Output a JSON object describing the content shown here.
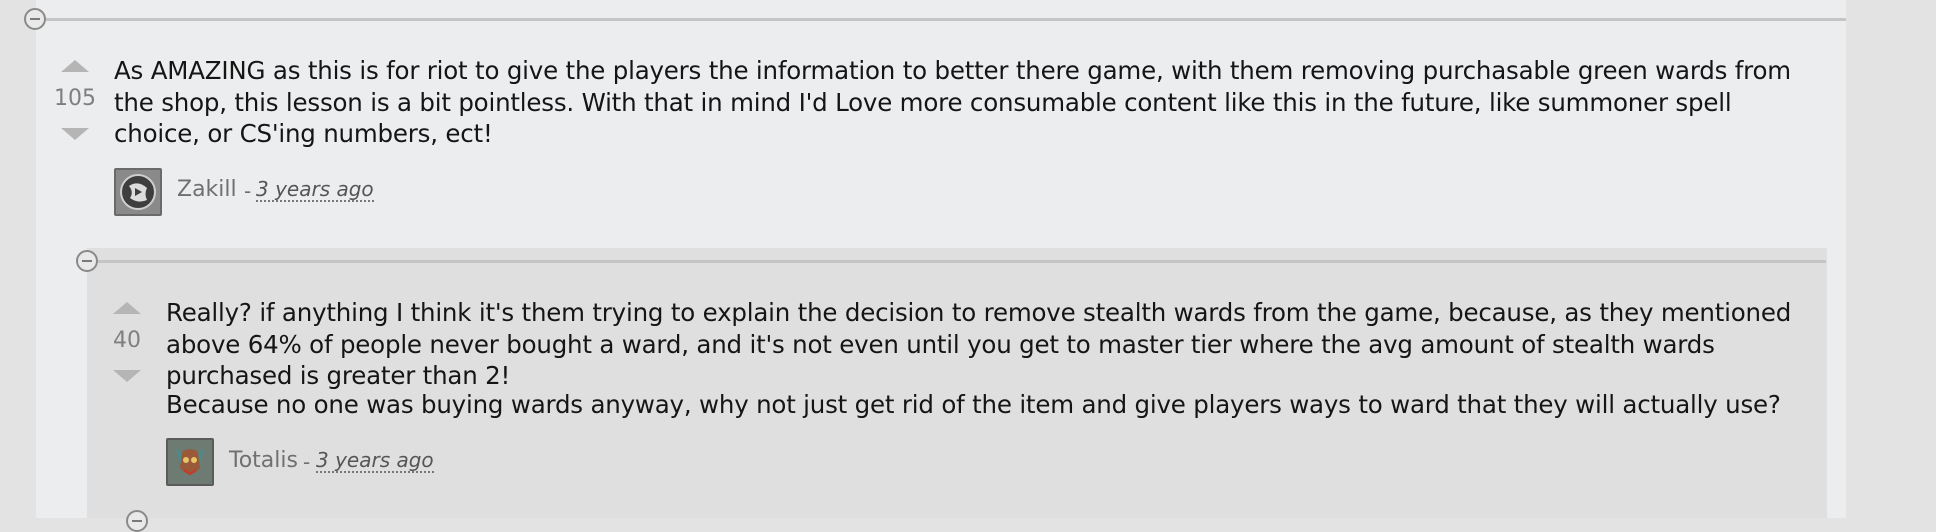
{
  "comments": [
    {
      "votes": "105",
      "text": "As AMAZING as this is for riot to give the players the information to better there game, with them removing purchasable green wards from the shop, this lesson is a bit pointless. With that in mind I'd Love more consumable content like this in the future, like summoner spell choice, or CS'ing numbers, ect!",
      "author": "Zakill",
      "separator": "-",
      "time": "3 years ago"
    },
    {
      "votes": "40",
      "text": "Really? if anything I think it's them trying to explain the decision to remove stealth wards from the game, because, as they mentioned above 64% of people never bought a ward, and it's not even until you get to master tier where the avg amount of stealth wards purchased is greater than 2!",
      "text2": "Because no one was buying wards anyway, why not just get rid of the item and give players ways to ward that they will actually use?",
      "author": "Totalis",
      "separator": "-",
      "time": "3 years ago"
    }
  ],
  "colors": {
    "page_bg": "#e3e3e3",
    "outer_panel": "#ecedee",
    "inner_panel": "#dfdfdf",
    "text": "#151515",
    "muted": "#7f7f7f"
  },
  "icons": [
    "collapse-icon",
    "upvote-icon",
    "downvote-icon"
  ]
}
